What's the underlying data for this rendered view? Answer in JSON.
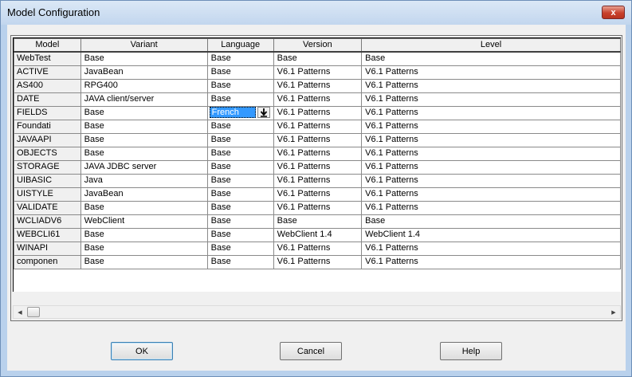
{
  "window": {
    "title": "Model Configuration",
    "close_label": "x"
  },
  "grid": {
    "columns": [
      "Model",
      "Variant",
      "Language",
      "Version",
      "Level"
    ],
    "rows": [
      {
        "model": "WebTest",
        "variant": "Base",
        "language": "Base",
        "version": "Base",
        "level": "Base"
      },
      {
        "model": "ACTIVE",
        "variant": "JavaBean",
        "language": "Base",
        "version": "V6.1 Patterns",
        "level": "V6.1 Patterns"
      },
      {
        "model": "AS400",
        "variant": "RPG400",
        "language": "Base",
        "version": "V6.1 Patterns",
        "level": "V6.1 Patterns"
      },
      {
        "model": "DATE",
        "variant": "JAVA client/server",
        "language": "Base",
        "version": "V6.1 Patterns",
        "level": "V6.1 Patterns"
      },
      {
        "model": "FIELDS",
        "variant": "Base",
        "language": "French",
        "version": "V6.1 Patterns",
        "level": "V6.1 Patterns"
      },
      {
        "model": "Foundati",
        "variant": "Base",
        "language": "Base",
        "version": "V6.1 Patterns",
        "level": "V6.1 Patterns"
      },
      {
        "model": "JAVAAPI",
        "variant": "Base",
        "language": "Base",
        "version": "V6.1 Patterns",
        "level": "V6.1 Patterns"
      },
      {
        "model": "OBJECTS",
        "variant": "Base",
        "language": "Base",
        "version": "V6.1 Patterns",
        "level": "V6.1 Patterns"
      },
      {
        "model": "STORAGE",
        "variant": "JAVA JDBC server",
        "language": "Base",
        "version": "V6.1 Patterns",
        "level": "V6.1 Patterns"
      },
      {
        "model": "UIBASIC",
        "variant": "Java",
        "language": "Base",
        "version": "V6.1 Patterns",
        "level": "V6.1 Patterns"
      },
      {
        "model": "UISTYLE",
        "variant": "JavaBean",
        "language": "Base",
        "version": "V6.1 Patterns",
        "level": "V6.1 Patterns"
      },
      {
        "model": "VALIDATE",
        "variant": "Base",
        "language": "Base",
        "version": "V6.1 Patterns",
        "level": "V6.1 Patterns"
      },
      {
        "model": "WCLIADV6",
        "variant": "WebClient",
        "language": "Base",
        "version": "Base",
        "level": "Base"
      },
      {
        "model": "WEBCLI61",
        "variant": "Base",
        "language": "Base",
        "version": "WebClient 1.4",
        "level": "WebClient 1.4"
      },
      {
        "model": "WINAPI",
        "variant": "Base",
        "language": "Base",
        "version": "V6.1 Patterns",
        "level": "V6.1 Patterns"
      },
      {
        "model": "componen",
        "variant": "Base",
        "language": "Base",
        "version": "V6.1 Patterns",
        "level": "V6.1 Patterns"
      }
    ],
    "editing_row_index": 4,
    "editing_value": "French"
  },
  "scrollbar": {
    "left_arrow": "◀",
    "right_arrow": "▶"
  },
  "buttons": {
    "ok": "OK",
    "cancel": "Cancel",
    "help": "Help"
  }
}
